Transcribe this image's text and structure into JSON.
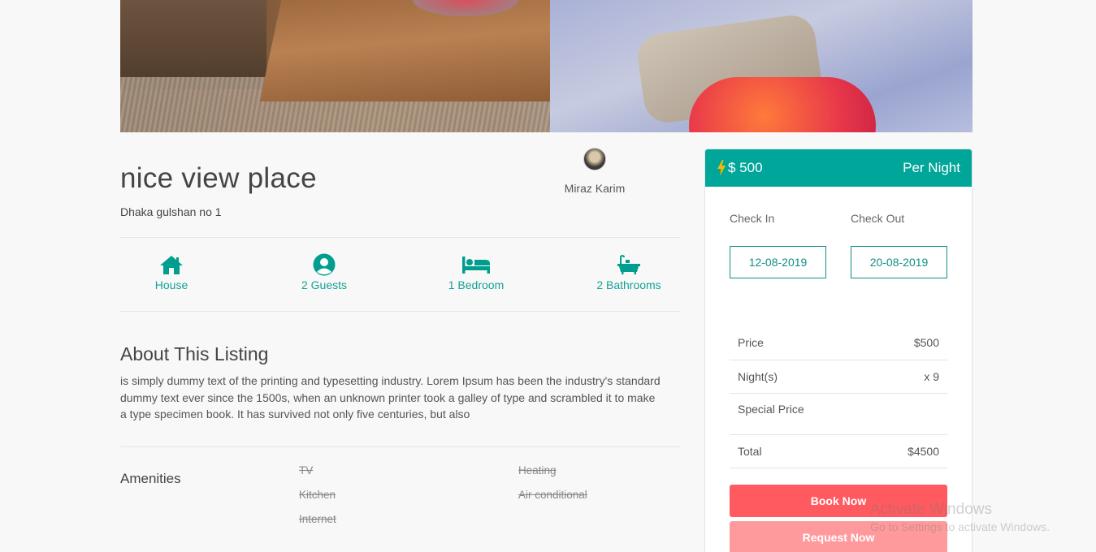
{
  "listing": {
    "title": "nice view place",
    "address": "Dhaka gulshan no 1"
  },
  "host": {
    "name": "Miraz Karim"
  },
  "features": [
    {
      "icon": "home-icon",
      "label": "House"
    },
    {
      "icon": "user-circle-icon",
      "label": "2 Guests"
    },
    {
      "icon": "bed-icon",
      "label": "1 Bedroom"
    },
    {
      "icon": "bath-icon",
      "label": "2 Bathrooms"
    }
  ],
  "about": {
    "heading": "About This Listing",
    "text": "is simply dummy text of the printing and typesetting industry. Lorem Ipsum has been the industry's standard dummy text ever since the 1500s, when an unknown printer took a galley of type and scrambled it to make a type specimen book. It has survived not only five centuries, but also"
  },
  "amenities": {
    "heading": "Amenities",
    "items": [
      "TV",
      "Heating",
      "Kitchen",
      "Air conditional",
      "Internet"
    ]
  },
  "booking": {
    "price": "$ 500",
    "per_night": "Per Night",
    "check_in_label": "Check In",
    "check_out_label": "Check Out",
    "check_in_date": "12-08-2019",
    "check_out_date": "20-08-2019",
    "summary": [
      {
        "label": "Price",
        "value": "$500"
      },
      {
        "label": "Night(s)",
        "value": "x 9"
      },
      {
        "label": "Special Price",
        "value": ""
      },
      {
        "label": "Total",
        "value": "$4500"
      }
    ],
    "book_label": "Book Now",
    "request_label": "Request Now"
  },
  "watermark": {
    "line1": "Activate Windows",
    "line2": "Go to Settings to activate Windows."
  },
  "colors": {
    "accent": "#00a699",
    "book": "#ff5a5f",
    "request": "#ff9a9c",
    "bolt": "#f5b800"
  }
}
